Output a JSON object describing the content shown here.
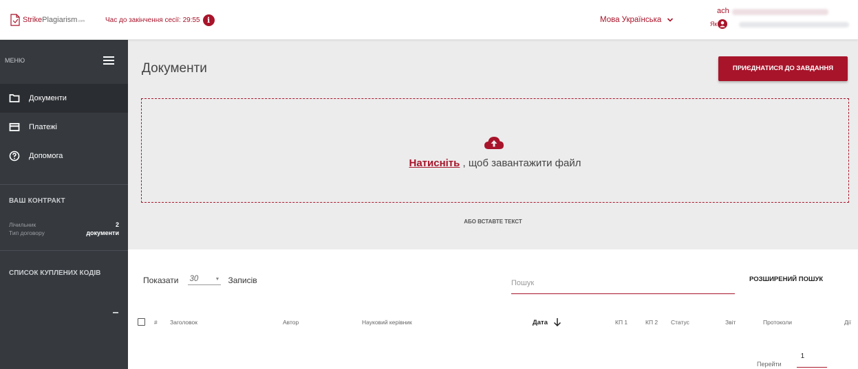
{
  "header": {
    "logo_brand": "Strike",
    "logo_plag": "Plagiarism",
    "logo_suffix": ".com",
    "session_label": "Час до закінчення сесії: 29:55",
    "info_symbol": "i",
    "language": "Мова Українська",
    "user_name": "ach",
    "user_role_prefix": "Як"
  },
  "sidebar": {
    "menu_label": "МЕНЮ",
    "items": [
      {
        "label": "Документи",
        "icon": "folder-icon"
      },
      {
        "label": "Платежі",
        "icon": "card-icon"
      },
      {
        "label": "Допомога",
        "icon": "help-icon"
      }
    ],
    "contract_title": "ВАШ КОНТРАКТ",
    "counter_label": "Лічильник",
    "counter_value": "2",
    "contract_type_label": "Тип договору",
    "contract_type_value": "документи",
    "codes_title": "СПИСОК КУПЛЕНИХ КОДІВ",
    "codes_value": "—"
  },
  "main": {
    "title": "Документи",
    "join_button": "ПРИЄДНАТИСЯ ДО ЗАВДАННЯ",
    "upload_click": "Натисніть",
    "upload_rest": " , щоб завантажити файл",
    "paste_text": "АБО ВСТАВТЕ ТЕКСТ",
    "show_label": "Показати",
    "page_size": "30",
    "records_label": "Записів",
    "search_placeholder": "Пошук",
    "advanced_search": "РОЗШИРЕНИЙ ПОШУК",
    "columns": {
      "num": "#",
      "title": "Заголовок",
      "author": "Автор",
      "supervisor": "Науковий керівник",
      "date": "Дата",
      "kp1": "КП 1",
      "kp2": "КП 2",
      "status": "Статус",
      "report": "Звіт",
      "protocols": "Протоколи",
      "actions": "Дії"
    },
    "goto_label": "Перейти",
    "goto_value": "1"
  },
  "colors": {
    "accent": "#a8142a",
    "sidebar_bg": "#363a3f",
    "content_bg": "#ececec"
  }
}
